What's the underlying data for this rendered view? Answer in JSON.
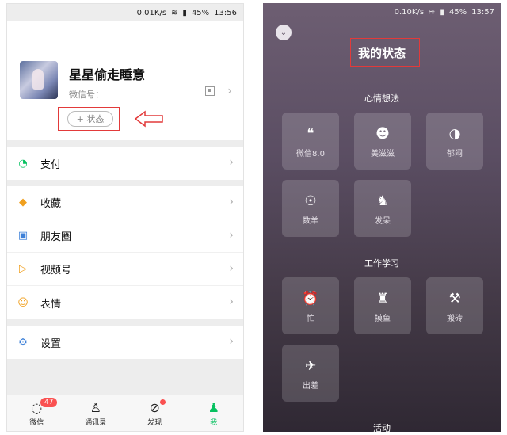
{
  "left": {
    "status": {
      "speed": "0.01K/s",
      "battery": "45%",
      "time": "13:56"
    },
    "profile": {
      "nickname": "星星偷走睡意",
      "wechat_id_label": "微信号：",
      "status_button": "+ 状态"
    },
    "menu_groups": [
      [
        {
          "label": "支付",
          "icon": "payment-icon",
          "color": "#07c160"
        }
      ],
      [
        {
          "label": "收藏",
          "icon": "favorites-icon",
          "color": "#f0a020"
        },
        {
          "label": "朋友圈",
          "icon": "moments-icon",
          "color": "#3d80d8"
        },
        {
          "label": "视频号",
          "icon": "channels-icon",
          "color": "#f0a020"
        },
        {
          "label": "表情",
          "icon": "stickers-icon",
          "color": "#f0a020"
        }
      ],
      [
        {
          "label": "设置",
          "icon": "settings-icon",
          "color": "#3d80d8"
        }
      ]
    ],
    "tabs": [
      {
        "label": "微信",
        "icon": "chat-icon",
        "badge": "47"
      },
      {
        "label": "通讯录",
        "icon": "contacts-icon"
      },
      {
        "label": "发现",
        "icon": "discover-icon"
      },
      {
        "label": "我",
        "icon": "me-icon"
      }
    ],
    "active_tab_color": "#07c160"
  },
  "right": {
    "status": {
      "speed": "0.10K/s",
      "battery": "45%",
      "time": "13:57"
    },
    "title": "我的状态",
    "sections": [
      {
        "title": "心情想法",
        "items": [
          {
            "label": "微信8.0",
            "icon": "wechat-chat-icon"
          },
          {
            "label": "美滋滋",
            "icon": "smile-face-icon"
          },
          {
            "label": "郁闷",
            "icon": "gloomy-face-icon"
          },
          {
            "label": "数羊",
            "icon": "sheep-face-icon"
          },
          {
            "label": "发呆",
            "icon": "daydream-icon"
          }
        ]
      },
      {
        "title": "工作学习",
        "items": [
          {
            "label": "忙",
            "icon": "busy-alarm-icon"
          },
          {
            "label": "摸鱼",
            "icon": "slacking-desk-icon"
          },
          {
            "label": "搬砖",
            "icon": "brick-work-icon"
          },
          {
            "label": "出差",
            "icon": "airplane-icon"
          }
        ]
      },
      {
        "title": "活动",
        "items": []
      }
    ]
  }
}
